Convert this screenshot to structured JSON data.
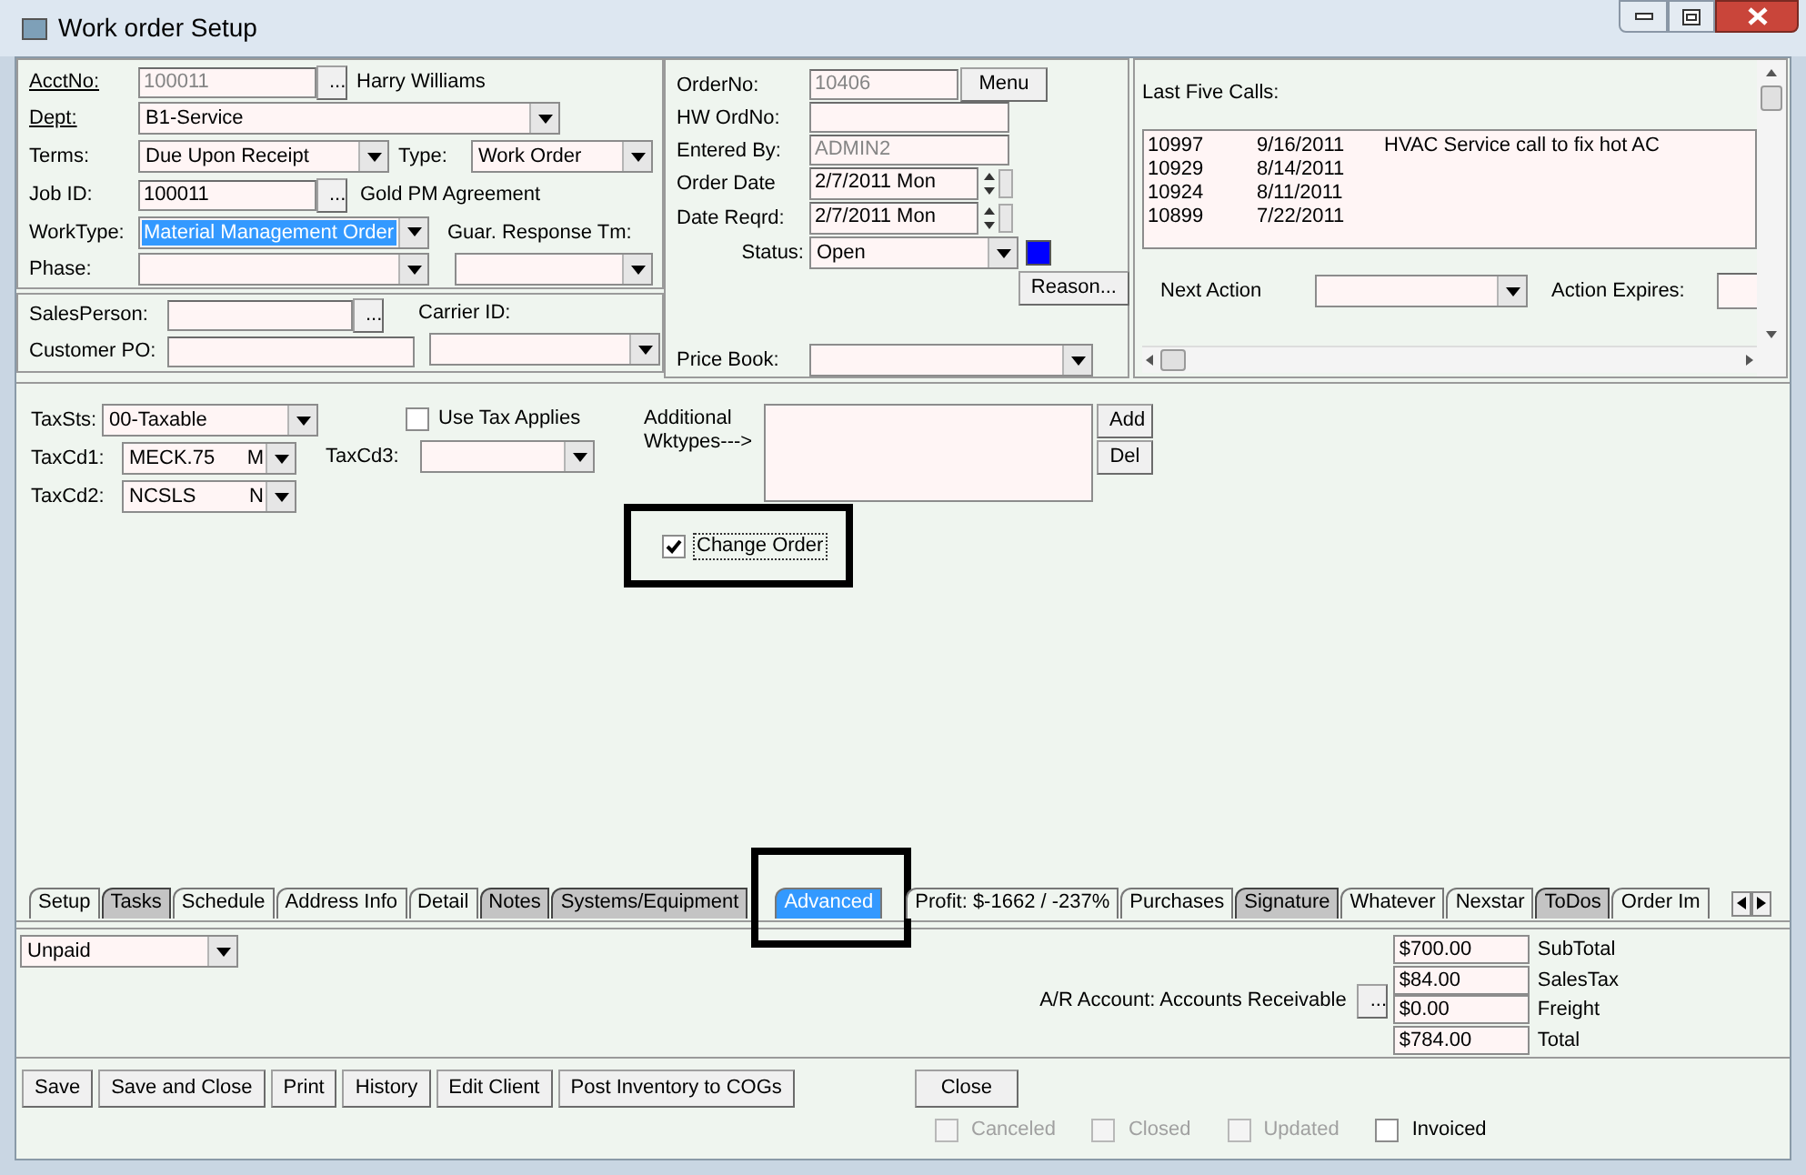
{
  "window": {
    "title": "Work order Setup"
  },
  "customer": {
    "acct_no": {
      "label": "AcctNo:",
      "value": "100011",
      "disabled": true,
      "lookup_button": "...",
      "client": "Harry Williams"
    },
    "dept": {
      "label": "Dept:",
      "value": "B1-Service"
    },
    "terms": {
      "label": "Terms:",
      "value": "Due Upon Receipt"
    },
    "type": {
      "label": "Type:",
      "value": "Work Order"
    },
    "job_id": {
      "label": "Job ID:",
      "value": "100011",
      "disabled": false,
      "lookup_button": "...",
      "agreement": "Gold PM Agreement"
    },
    "work_type": {
      "label": "WorkType:",
      "value": "Material Management Order",
      "highlighted": true
    },
    "guar_response": {
      "label": "Guar. Response Tm:"
    },
    "phase": {
      "label": "Phase:"
    },
    "sales_person": {
      "label": "SalesPerson:",
      "lookup_button": "..."
    },
    "carrier_id": {
      "label": "Carrier ID:"
    },
    "customer_po": {
      "label": "Customer PO:"
    }
  },
  "order": {
    "order_no": {
      "label": "OrderNo:",
      "value": "10406",
      "disabled": true
    },
    "menu_button": "Menu",
    "hw_ord_no": {
      "label": "HW OrdNo:"
    },
    "entered_by": {
      "label": "Entered By:",
      "value": "ADMIN2",
      "disabled": true
    },
    "order_date": {
      "label": "Order Date",
      "value": "2/7/2011 Mon"
    },
    "date_reqrd": {
      "label": "Date Reqrd:",
      "value": "2/7/2011 Mon"
    },
    "status": {
      "label": "Status:",
      "value": "Open",
      "color": "#0000ff"
    },
    "reason_button": "Reason...",
    "price_book": {
      "label": "Price Book:"
    }
  },
  "calls": {
    "title": "Last Five Calls:",
    "rows": [
      {
        "order": "10997",
        "date": "9/16/2011",
        "description": "HVAC Service call to fix hot AC"
      },
      {
        "order": "10929",
        "date": "8/14/2011"
      },
      {
        "order": "10924",
        "date": "8/11/2011"
      },
      {
        "order": "10899",
        "date": "7/22/2011"
      }
    ],
    "next_action": {
      "label": "Next Action"
    },
    "action_expires": {
      "label": "Action Expires:"
    }
  },
  "tax": {
    "tax_sts": {
      "label": "TaxSts:",
      "value": "00-Taxable"
    },
    "tax_cd1": {
      "label": "TaxCd1:",
      "value": "MECK.75",
      "column_2": "M"
    },
    "tax_cd2": {
      "label": "TaxCd2:",
      "value": "NCSLS",
      "column_2": "N"
    },
    "use_tax": {
      "label": "Use Tax Applies",
      "checked": false
    },
    "tax_cd3": {
      "label": "TaxCd3:"
    }
  },
  "additional_wktypes": {
    "label": "Additional Wktypes--->",
    "add_button": "Add",
    "del_button": "Del"
  },
  "change_order": {
    "label": "Change Order",
    "checked": true,
    "framed": true
  },
  "tabs": [
    {
      "label": "Setup",
      "selected": false,
      "shaded": false,
      "framed": false
    },
    {
      "label": "Tasks",
      "selected": false,
      "shaded": true,
      "framed": false
    },
    {
      "label": "Schedule",
      "selected": false,
      "shaded": false,
      "framed": false
    },
    {
      "label": "Address Info",
      "selected": false,
      "shaded": false,
      "framed": false
    },
    {
      "label": "Detail",
      "selected": false,
      "shaded": false,
      "framed": false
    },
    {
      "label": "Notes",
      "selected": false,
      "shaded": true,
      "framed": false
    },
    {
      "label": "Systems/Equipment",
      "selected": false,
      "shaded": true,
      "framed": false
    },
    {
      "label": "Advanced",
      "selected": true,
      "shaded": false,
      "framed": true
    },
    {
      "label": "Profit: $-1662 / -237%",
      "selected": false,
      "shaded": false,
      "framed": false
    },
    {
      "label": "Purchases",
      "selected": false,
      "shaded": false,
      "framed": false
    },
    {
      "label": "Signature",
      "selected": false,
      "shaded": true,
      "framed": false
    },
    {
      "label": "Whatever",
      "selected": false,
      "shaded": false,
      "framed": false
    },
    {
      "label": "Nexstar",
      "selected": false,
      "shaded": false,
      "framed": false
    },
    {
      "label": "ToDos",
      "selected": false,
      "shaded": true,
      "framed": false
    },
    {
      "label": "Order Im",
      "selected": false,
      "shaded": false,
      "framed": false
    }
  ],
  "payment_status": {
    "value": "Unpaid"
  },
  "ar_account": {
    "label": "A/R Account: Accounts Receivable",
    "lookup_button": "..."
  },
  "totals": [
    {
      "value": "$700.00",
      "label": "SubTotal"
    },
    {
      "value": "$84.00",
      "label": "SalesTax"
    },
    {
      "value": "$0.00",
      "label": "Freight"
    },
    {
      "value": "$784.00",
      "label": "Total"
    }
  ],
  "buttons": [
    "Save",
    "Save and Close",
    "Print",
    "History",
    "Edit Client",
    "Post Inventory to COGs"
  ],
  "close_button": "Close",
  "flags": [
    {
      "label": "Canceled",
      "checked": false,
      "disabled": true
    },
    {
      "label": "Closed",
      "checked": false,
      "disabled": true
    },
    {
      "label": "Updated",
      "checked": false,
      "disabled": true
    },
    {
      "label": "Invoiced",
      "checked": false,
      "disabled": false
    }
  ]
}
